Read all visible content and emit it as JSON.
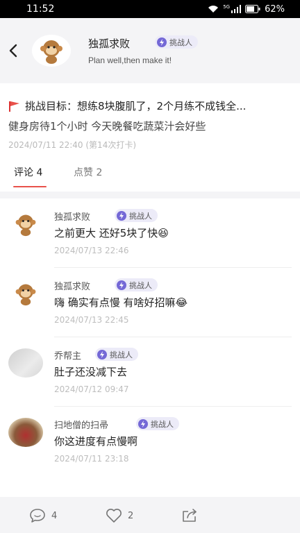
{
  "status_bar": {
    "time": "11:52",
    "battery": "62%",
    "network": "5G"
  },
  "header": {
    "user_name": "独孤求败",
    "badge_label": "挑战人",
    "motto": "Plan well,then make it!"
  },
  "post": {
    "goal": "挑战目标：想练8块腹肌了，2个月练不成钱全...",
    "checkin": "健身房待1个小时 今天晚餐吃蔬菜汁会好些",
    "meta": "2024/07/11 22:40 (第14次打卡)"
  },
  "tabs": [
    {
      "label": "评论 4"
    },
    {
      "label": "点赞 2"
    }
  ],
  "comments": [
    {
      "name": "独孤求败",
      "badge": "挑战人",
      "text": "之前更大 还好5块了快😆",
      "date": "2024/07/13 22:46",
      "avatar": "monkey-avatar"
    },
    {
      "name": "独孤求败",
      "badge": "挑战人",
      "text": "嗨 确实有点慢 有啥好招嘛😂",
      "date": "2024/07/13 22:45",
      "avatar": "monkey-avatar"
    },
    {
      "name": "乔帮主",
      "badge": "挑战人",
      "text": "肚子还没减下去",
      "date": "2024/07/12 09:47",
      "avatar": "gray-avatar"
    },
    {
      "name": "扫地僧的扫帚",
      "badge": "挑战人",
      "text": "你这进度有点慢啊",
      "date": "2024/07/11 23:18",
      "avatar": "crowd-avatar"
    }
  ],
  "bottom_bar": {
    "comment_count": "4",
    "like_count": "2"
  },
  "colors": {
    "accent": "#e8514a",
    "badge_bg": "#ecebf8",
    "bolt": "#7468d6"
  }
}
